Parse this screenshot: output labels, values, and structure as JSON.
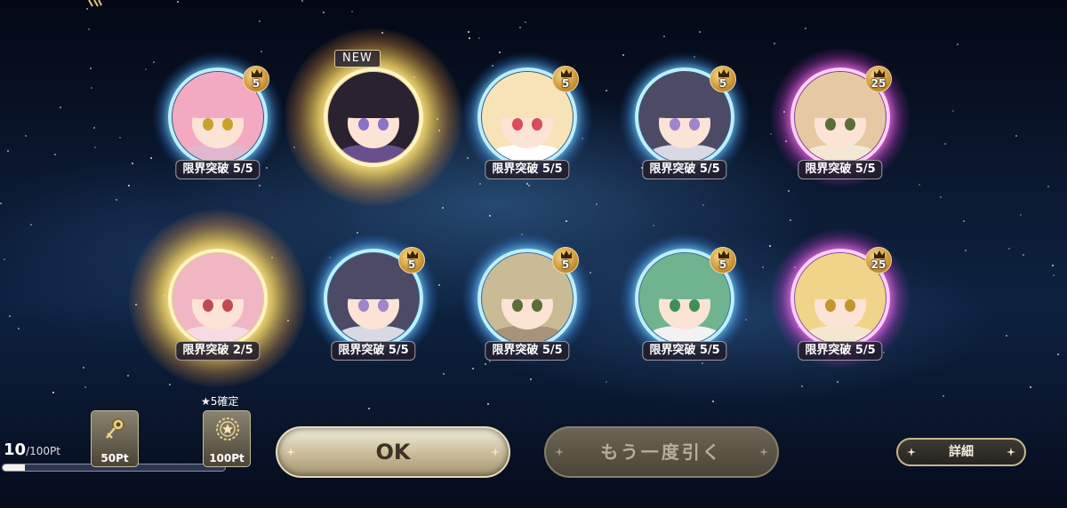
{
  "summon_results": [
    {
      "label": "限界突破 5/5",
      "badge": "5",
      "rarity": "blue",
      "new": false,
      "hair": "#f4a9c2",
      "eyes": "#c8a12a",
      "outfit": "#e1b7cf"
    },
    {
      "label": "",
      "badge": "",
      "rarity": "gold",
      "new": true,
      "new_label": "NEW",
      "hair": "#2a2230",
      "eyes": "#8a72c9",
      "outfit": "#6a4f8f"
    },
    {
      "label": "限界突破 5/5",
      "badge": "5",
      "rarity": "blue",
      "new": false,
      "hair": "#f7e3b7",
      "eyes": "#d94c5c",
      "outfit": "#ffffff"
    },
    {
      "label": "限界突破 5/5",
      "badge": "5",
      "rarity": "blue",
      "new": false,
      "hair": "#4d4a66",
      "eyes": "#a085cc",
      "outfit": "#d9d9e6"
    },
    {
      "label": "限界突破 5/5",
      "badge": "25",
      "rarity": "pink",
      "new": false,
      "hair": "#e6c9a2",
      "eyes": "#5a6e3a",
      "outfit": "#f4e8d4"
    },
    {
      "label": "限界突破 2/5",
      "badge": "",
      "rarity": "gold",
      "new": false,
      "hair": "#f0b6c3",
      "eyes": "#c04a52",
      "outfit": "#f6dbe3"
    },
    {
      "label": "限界突破 5/5",
      "badge": "5",
      "rarity": "blue",
      "new": false,
      "hair": "#4d4a66",
      "eyes": "#a085cc",
      "outfit": "#d9d9e6"
    },
    {
      "label": "限界突破 5/5",
      "badge": "5",
      "rarity": "blue",
      "new": false,
      "hair": "#c9bb95",
      "eyes": "#5a6e3a",
      "outfit": "#a7937a"
    },
    {
      "label": "限界突破 5/5",
      "badge": "5",
      "rarity": "blue",
      "new": false,
      "hair": "#6fb48f",
      "eyes": "#3f8f58",
      "outfit": "#f2f2f2"
    },
    {
      "label": "限界突破 5/5",
      "badge": "25",
      "rarity": "pink",
      "new": false,
      "hair": "#f0d48a",
      "eyes": "#c4952a",
      "outfit": "#f3e8cf"
    }
  ],
  "points": {
    "current": "10",
    "max_text": "/100Pt",
    "progress_fraction": 0.1
  },
  "rewards": [
    {
      "label": "50Pt",
      "icon": "key-icon"
    },
    {
      "label": "100Pt",
      "icon": "star-medal-icon"
    }
  ],
  "guarantee_label": "★5確定",
  "buttons": {
    "ok": "OK",
    "retry": "もう一度引く",
    "details": "詳細"
  }
}
